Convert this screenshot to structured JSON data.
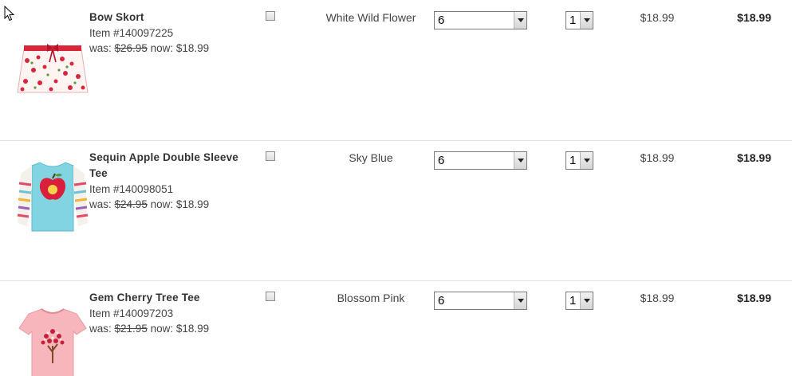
{
  "items": [
    {
      "name": "Bow Skort",
      "item_number": "Item #140097225",
      "was_label": "was:",
      "was_price": "$26.95",
      "now_label": "now:",
      "now_price": "$18.99",
      "color": "White Wild Flower",
      "size": "6",
      "qty": "1",
      "price": "$18.99",
      "total": "$18.99",
      "thumb_icon": "floral-skort-icon"
    },
    {
      "name": "Sequin Apple Double Sleeve Tee",
      "item_number": "Item #140098051",
      "was_label": "was:",
      "was_price": "$24.95",
      "now_label": "now:",
      "now_price": "$18.99",
      "color": "Sky Blue",
      "size": "6",
      "qty": "1",
      "price": "$18.99",
      "total": "$18.99",
      "thumb_icon": "blue-apple-tee-icon"
    },
    {
      "name": "Gem Cherry Tree Tee",
      "item_number": "Item #140097203",
      "was_label": "was:",
      "was_price": "$21.95",
      "now_label": "now:",
      "now_price": "$18.99",
      "color": "Blossom Pink",
      "size": "6",
      "qty": "1",
      "price": "$18.99",
      "total": "$18.99",
      "thumb_icon": "pink-cherry-tree-tee-icon"
    }
  ],
  "colors": {
    "divider": "#e2e2e2",
    "skort_red": "#c8102e",
    "tee_blue": "#7fd3e0",
    "tee_pink": "#f7b8bd"
  }
}
